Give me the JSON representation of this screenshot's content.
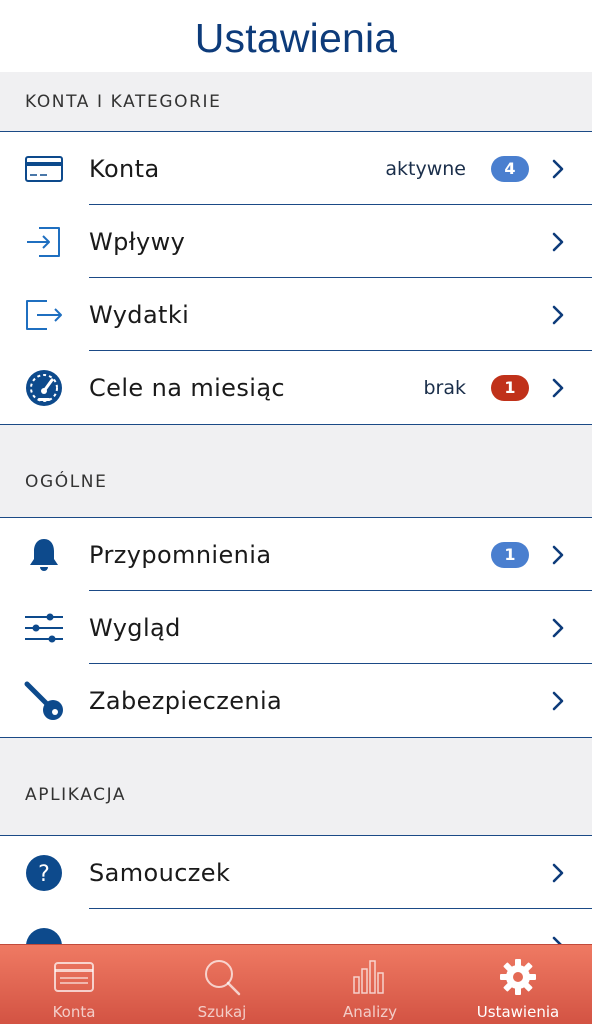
{
  "header": {
    "title": "Ustawienia"
  },
  "colors": {
    "accent": "#0d3b7a",
    "badge_info": "#4a7fcf",
    "badge_alert": "#c0311a",
    "tabbar": "#e46a55"
  },
  "sections": {
    "accounts": {
      "title": "KONTA I KATEGORIE",
      "items": [
        {
          "icon": "card-icon",
          "label": "Konta",
          "status": "aktywne",
          "badge": "4",
          "badge_color": "#4a7fcf"
        },
        {
          "icon": "income-icon",
          "label": "Wpływy"
        },
        {
          "icon": "expense-icon",
          "label": "Wydatki"
        },
        {
          "icon": "speedometer-icon",
          "label": "Cele na miesiąc",
          "status": "brak",
          "badge": "1",
          "badge_color": "#c0311a"
        }
      ]
    },
    "general": {
      "title": "OGÓLNE",
      "items": [
        {
          "icon": "bell-icon",
          "label": "Przypomnienia",
          "badge": "1",
          "badge_color": "#4a7fcf"
        },
        {
          "icon": "sliders-icon",
          "label": "Wygląd"
        },
        {
          "icon": "key-icon",
          "label": "Zabezpieczenia"
        }
      ]
    },
    "app": {
      "title": "APLIKACJA",
      "items": [
        {
          "icon": "help-icon",
          "label": "Samouczek"
        }
      ]
    }
  },
  "tabbar": {
    "tabs": [
      {
        "icon": "card-icon",
        "label": "Konta",
        "active": false
      },
      {
        "icon": "search-icon",
        "label": "Szukaj",
        "active": false
      },
      {
        "icon": "chart-icon",
        "label": "Analizy",
        "active": false
      },
      {
        "icon": "gear-icon",
        "label": "Ustawienia",
        "active": true
      }
    ]
  }
}
